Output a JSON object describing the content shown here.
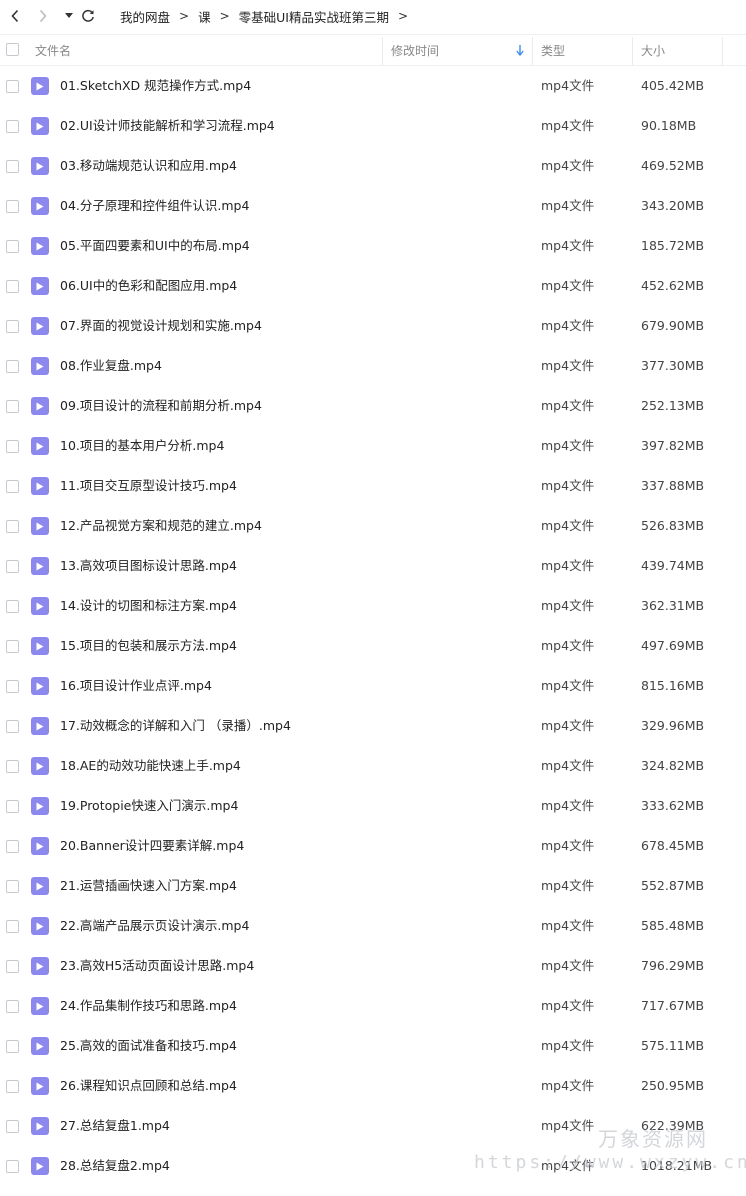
{
  "breadcrumb": {
    "items": [
      "我的网盘",
      "课",
      "零基础UI精品实战班第三期"
    ],
    "trailing": ">"
  },
  "header": {
    "name": "文件名",
    "modified": "修改时间",
    "type": "类型",
    "size": "大小"
  },
  "colors": {
    "file_icon": "#8c88ee",
    "sort_arrow": "#3a8ee6"
  },
  "files": [
    {
      "name": "01.SketchXD 规范操作方式.mp4",
      "type": "mp4文件",
      "size": "405.42MB"
    },
    {
      "name": "02.UI设计师技能解析和学习流程.mp4",
      "type": "mp4文件",
      "size": "90.18MB"
    },
    {
      "name": "03.移动端规范认识和应用.mp4",
      "type": "mp4文件",
      "size": "469.52MB"
    },
    {
      "name": "04.分子原理和控件组件认识.mp4",
      "type": "mp4文件",
      "size": "343.20MB"
    },
    {
      "name": "05.平面四要素和UI中的布局.mp4",
      "type": "mp4文件",
      "size": "185.72MB"
    },
    {
      "name": "06.UI中的色彩和配图应用.mp4",
      "type": "mp4文件",
      "size": "452.62MB"
    },
    {
      "name": "07.界面的视觉设计规划和实施.mp4",
      "type": "mp4文件",
      "size": "679.90MB"
    },
    {
      "name": "08.作业复盘.mp4",
      "type": "mp4文件",
      "size": "377.30MB"
    },
    {
      "name": "09.项目设计的流程和前期分析.mp4",
      "type": "mp4文件",
      "size": "252.13MB"
    },
    {
      "name": "10.项目的基本用户分析.mp4",
      "type": "mp4文件",
      "size": "397.82MB"
    },
    {
      "name": "11.项目交互原型设计技巧.mp4",
      "type": "mp4文件",
      "size": "337.88MB"
    },
    {
      "name": "12.产品视觉方案和规范的建立.mp4",
      "type": "mp4文件",
      "size": "526.83MB"
    },
    {
      "name": "13.高效项目图标设计思路.mp4",
      "type": "mp4文件",
      "size": "439.74MB"
    },
    {
      "name": "14.设计的切图和标注方案.mp4",
      "type": "mp4文件",
      "size": "362.31MB"
    },
    {
      "name": "15.项目的包装和展示方法.mp4",
      "type": "mp4文件",
      "size": "497.69MB"
    },
    {
      "name": "16.项目设计作业点评.mp4",
      "type": "mp4文件",
      "size": "815.16MB"
    },
    {
      "name": "17.动效概念的详解和入门 （录播）.mp4",
      "type": "mp4文件",
      "size": "329.96MB"
    },
    {
      "name": "18.AE的动效功能快速上手.mp4",
      "type": "mp4文件",
      "size": "324.82MB"
    },
    {
      "name": "19.Protopie快速入门演示.mp4",
      "type": "mp4文件",
      "size": "333.62MB"
    },
    {
      "name": "20.Banner设计四要素详解.mp4",
      "type": "mp4文件",
      "size": "678.45MB"
    },
    {
      "name": "21.运营插画快速入门方案.mp4",
      "type": "mp4文件",
      "size": "552.87MB"
    },
    {
      "name": "22.高端产品展示页设计演示.mp4",
      "type": "mp4文件",
      "size": "585.48MB"
    },
    {
      "name": "23.高效H5活动页面设计思路.mp4",
      "type": "mp4文件",
      "size": "796.29MB"
    },
    {
      "name": "24.作品集制作技巧和思路.mp4",
      "type": "mp4文件",
      "size": "717.67MB"
    },
    {
      "name": "25.高效的面试准备和技巧.mp4",
      "type": "mp4文件",
      "size": "575.11MB"
    },
    {
      "name": "26.课程知识点回顾和总结.mp4",
      "type": "mp4文件",
      "size": "250.95MB"
    },
    {
      "name": "27.总结复盘1.mp4",
      "type": "mp4文件",
      "size": "622.39MB"
    },
    {
      "name": "28.总结复盘2.mp4",
      "type": "mp4文件",
      "size": "1018.21MB"
    }
  ],
  "watermark": {
    "name": "万象资源网",
    "url": "https://www.wxzyw.cn"
  }
}
